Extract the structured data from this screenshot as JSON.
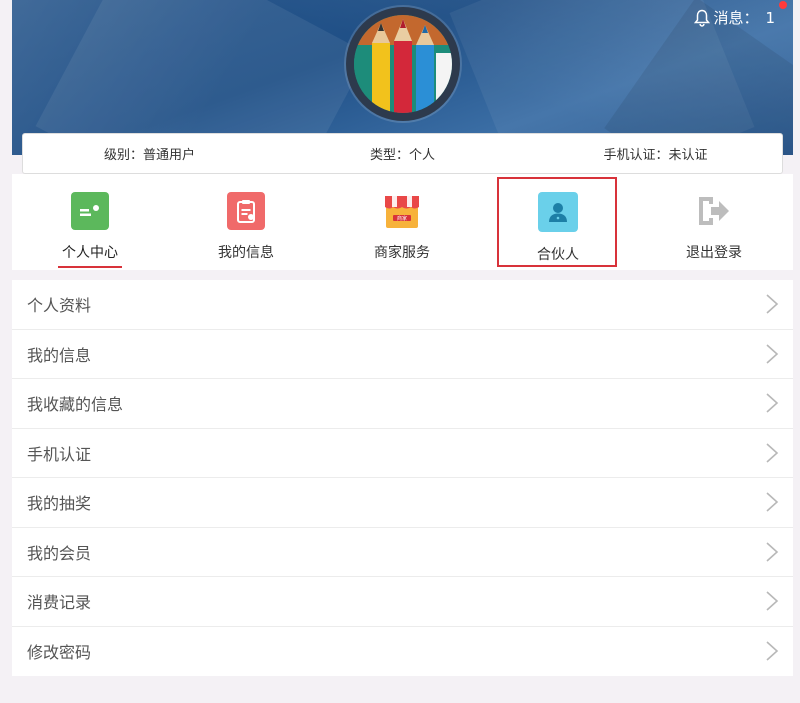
{
  "header": {
    "notice_label": "消息：",
    "notice_count": "1"
  },
  "info": {
    "level": "级别：普通用户",
    "type": "类型：个人",
    "phone_auth": "手机认证：未认证"
  },
  "nav": {
    "items": [
      {
        "label": "个人中心",
        "icon": "id-card-icon",
        "color": "#5cb85c"
      },
      {
        "label": "我的信息",
        "icon": "clipboard-icon",
        "color": "#f06a6a"
      },
      {
        "label": "商家服务",
        "icon": "shop-icon",
        "color": "#f7b23b"
      },
      {
        "label": "合伙人",
        "icon": "user-icon",
        "color": "#5ec8e5"
      },
      {
        "label": "退出登录",
        "icon": "logout-icon",
        "color": "#c9c9c9"
      }
    ],
    "shop_badge": "商家"
  },
  "menu": {
    "items": [
      {
        "label": "个人资料"
      },
      {
        "label": "我的信息"
      },
      {
        "label": "我收藏的信息"
      },
      {
        "label": "手机认证"
      },
      {
        "label": "我的抽奖"
      },
      {
        "label": "我的会员"
      },
      {
        "label": "消费记录"
      },
      {
        "label": "修改密码"
      }
    ]
  },
  "colors": {
    "accent": "#d8323a"
  }
}
